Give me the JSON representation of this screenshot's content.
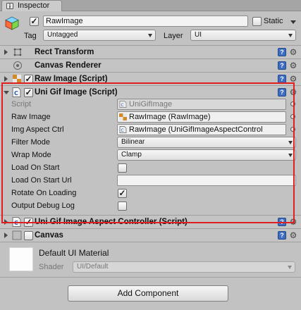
{
  "tab": {
    "label": "Inspector"
  },
  "gameobject": {
    "name": "RawImage",
    "active": true,
    "static_label": "Static",
    "static_checked": false,
    "tag_label": "Tag",
    "tag_value": "Untagged",
    "layer_label": "Layer",
    "layer_value": "UI"
  },
  "components": {
    "rect_transform": {
      "title": "Rect Transform"
    },
    "canvas_renderer": {
      "title": "Canvas Renderer"
    },
    "raw_image": {
      "title": "Raw Image (Script)",
      "enabled": true
    },
    "uni_gif": {
      "title": "Uni Gif Image (Script)",
      "enabled": true,
      "script_label": "Script",
      "script_value": "UniGifImage",
      "raw_image_label": "Raw Image",
      "raw_image_value": "RawImage (RawImage)",
      "aspect_label": "Img Aspect Ctrl",
      "aspect_value": "RawImage (UniGifImageAspectControl",
      "filter_label": "Filter Mode",
      "filter_value": "Bilinear",
      "wrap_label": "Wrap Mode",
      "wrap_value": "Clamp",
      "load_on_start_label": "Load On Start",
      "load_on_start_checked": false,
      "load_url_label": "Load On Start Url",
      "load_url_value": "",
      "rotate_label": "Rotate On Loading",
      "rotate_checked": true,
      "debug_label": "Output Debug Log",
      "debug_checked": false
    },
    "aspect_controller": {
      "title": "Uni Gif Image Aspect Controller (Script)",
      "enabled": true
    },
    "canvas": {
      "title": "Canvas",
      "enabled": false
    }
  },
  "material": {
    "name": "Default UI Material",
    "shader_label": "Shader",
    "shader_value": "UI/Default"
  },
  "add_component": {
    "label": "Add Component"
  },
  "colors": {
    "highlight": "#e02020",
    "help_blue": "#3d6cc0"
  }
}
